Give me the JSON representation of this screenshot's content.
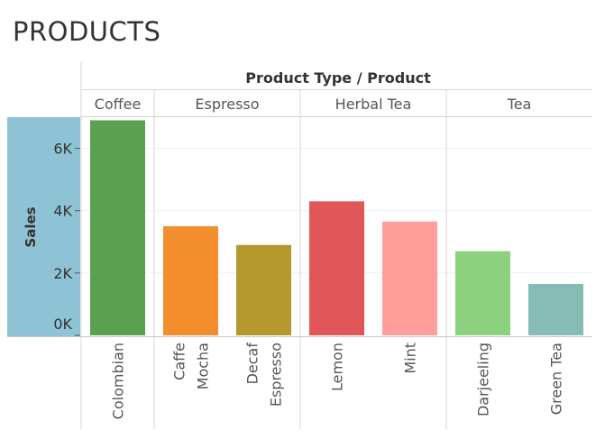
{
  "page": {
    "title": "PRODUCTS"
  },
  "chart_data": {
    "type": "bar",
    "title": "PRODUCTS",
    "column_header": "Product Type / Product",
    "ylabel": "Sales",
    "xlabel": "",
    "ylim": [
      0,
      7000
    ],
    "yticks": [
      {
        "value": 6000,
        "label": "6K"
      },
      {
        "value": 4000,
        "label": "4K"
      },
      {
        "value": 2000,
        "label": "2K"
      },
      {
        "value": 0,
        "label": "0K"
      }
    ],
    "grid": true,
    "groups": [
      {
        "name": "Coffee",
        "products": [
          {
            "lines": [
              "Colombian"
            ],
            "value": 6900,
            "color": "#59a14f"
          }
        ]
      },
      {
        "name": "Espresso",
        "products": [
          {
            "lines": [
              "Caffe",
              "Mocha"
            ],
            "value": 3500,
            "color": "#f28e2b"
          },
          {
            "lines": [
              "Decaf",
              "Espresso"
            ],
            "value": 2900,
            "color": "#b6992d"
          }
        ]
      },
      {
        "name": "Herbal Tea",
        "products": [
          {
            "lines": [
              "Lemon"
            ],
            "value": 4300,
            "color": "#e15759"
          },
          {
            "lines": [
              "Mint"
            ],
            "value": 3650,
            "color": "#ff9d9a"
          }
        ]
      },
      {
        "name": "Tea",
        "products": [
          {
            "lines": [
              "Darjeeling"
            ],
            "value": 2700,
            "color": "#8cd17d"
          },
          {
            "lines": [
              "Green Tea"
            ],
            "value": 1650,
            "color": "#86bcb6"
          }
        ]
      }
    ],
    "axis_panel_color": "#8ec3d5"
  }
}
